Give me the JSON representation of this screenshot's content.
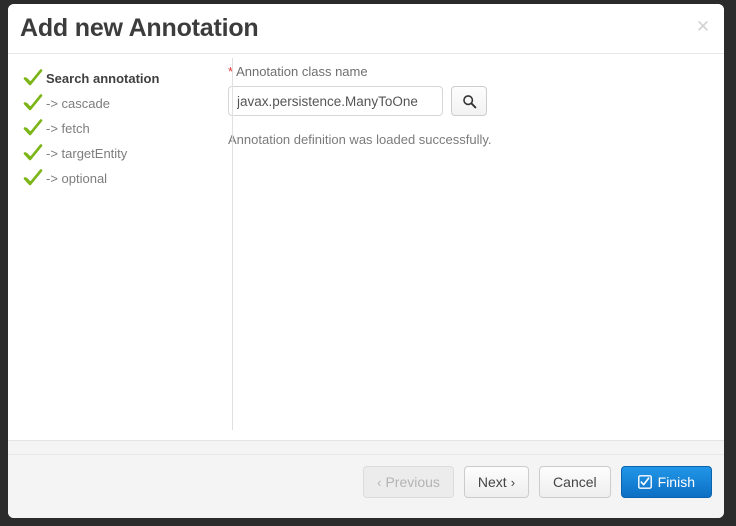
{
  "dialog": {
    "title": "Add new Annotation",
    "close_icon": "close-icon"
  },
  "steps": [
    {
      "label": "Search annotation",
      "icon": "green-check-icon",
      "current": true
    },
    {
      "label": "-> cascade",
      "icon": "green-check-icon",
      "current": false
    },
    {
      "label": "-> fetch",
      "icon": "green-check-icon",
      "current": false
    },
    {
      "label": "-> targetEntity",
      "icon": "green-check-icon",
      "current": false
    },
    {
      "label": "-> optional",
      "icon": "green-check-icon",
      "current": false
    }
  ],
  "form": {
    "required_marker": "*",
    "field_label": "Annotation class name",
    "input_value": "javax.persistence.ManyToOne",
    "input_placeholder": "",
    "search_icon": "search-icon",
    "status_message": "Annotation definition was loaded successfully."
  },
  "footer": {
    "previous_label": "Previous",
    "previous_chevron": "‹",
    "next_label": "Next",
    "next_chevron": "›",
    "cancel_label": "Cancel",
    "finish_label": "Finish",
    "finish_icon": "checked-checkbox-icon"
  },
  "colors": {
    "check_green": "#7cb518",
    "required_red": "#e03b3b",
    "primary_blue": "#1580d8",
    "backdrop": "#2b2b2b"
  }
}
